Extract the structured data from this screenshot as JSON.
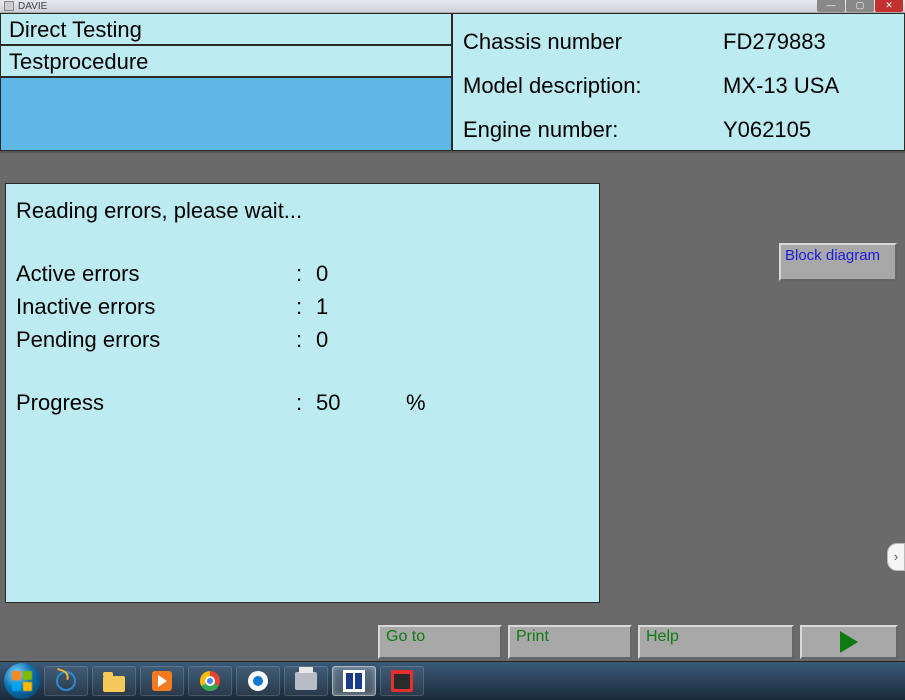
{
  "window": {
    "title": "DAVIE"
  },
  "header": {
    "left": {
      "row1": "Direct Testing",
      "row2": "Testprocedure"
    },
    "right": {
      "chassis_label": "Chassis number",
      "chassis_value": "FD279883",
      "model_label": "Model description:",
      "model_value": "MX-13 USA",
      "engine_label": "Engine number:",
      "engine_value": "Y062105"
    }
  },
  "status": {
    "title": "Reading errors, please wait...",
    "active_label": "Active errors",
    "active_value": "0",
    "inactive_label": "Inactive errors",
    "inactive_value": "1",
    "pending_label": "Pending errors",
    "pending_value": "0",
    "progress_label": "Progress",
    "progress_value": "50",
    "progress_unit": "%"
  },
  "buttons": {
    "block_diagram": "Block diagram",
    "goto": "Go to",
    "print": "Print",
    "help": "Help"
  }
}
